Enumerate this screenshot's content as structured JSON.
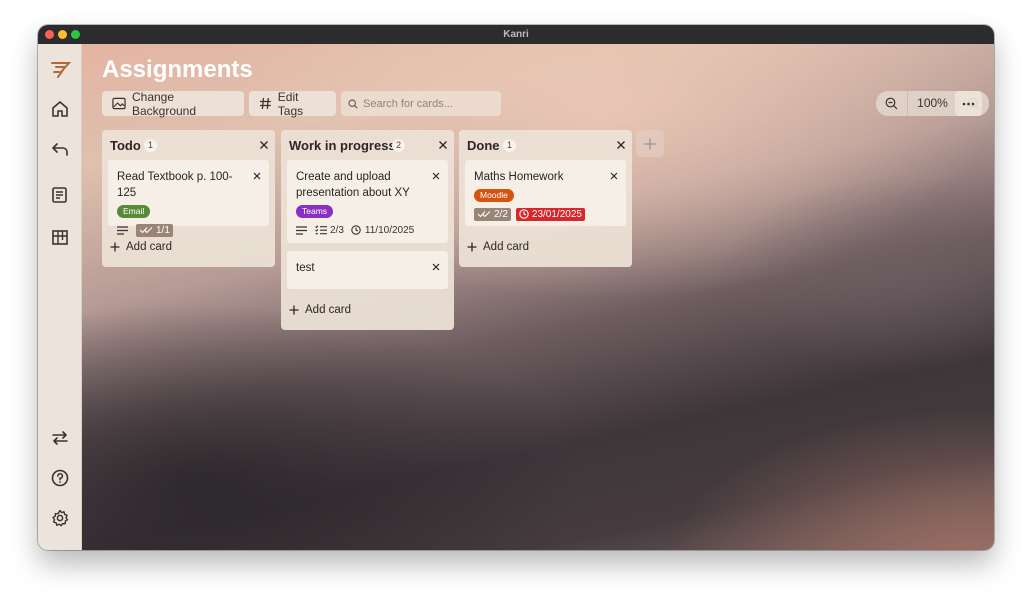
{
  "window": {
    "title": "Kanri"
  },
  "board": {
    "title": "Assignments"
  },
  "toolbar": {
    "change_background": "Change Background",
    "edit_tags": "Edit Tags",
    "search_placeholder": "Search for cards...",
    "zoom_level": "100%"
  },
  "sidebar": {
    "top_icons": [
      "logo-icon",
      "home-icon",
      "back-icon",
      "boards-icon",
      "kanban-icon"
    ],
    "bottom_icons": [
      "import-export-icon",
      "help-icon",
      "settings-icon"
    ]
  },
  "columns": [
    {
      "title": "Todo",
      "count": "1",
      "cards": [
        {
          "title": "Read Textbook p. 100-125",
          "tag": "Email",
          "tag_color": "#5a8a35",
          "has_description": true,
          "checklist": "1/1",
          "checklist_done": true
        }
      ],
      "add_label": "Add card"
    },
    {
      "title": "Work in progress",
      "count": "2",
      "cards": [
        {
          "title": "Create and upload presentation about XY",
          "tag": "Teams",
          "tag_color": "#8a2fc2",
          "has_description": true,
          "checklist": "2/3",
          "checklist_done": false,
          "due": "11/10/2025",
          "due_overdue": false
        },
        {
          "title": "test"
        }
      ],
      "add_label": "Add card"
    },
    {
      "title": "Done",
      "count": "1",
      "cards": [
        {
          "title": "Maths Homework",
          "tag": "Moodle",
          "tag_color": "#d6530f",
          "checklist": "2/2",
          "checklist_done": true,
          "due": "23/01/2025",
          "due_overdue": true,
          "due_color": "#d9262b"
        }
      ],
      "add_label": "Add card"
    }
  ],
  "colors": {
    "accent_logo": "#b06a3a",
    "checklist_done_bg": "#9a8377",
    "overdue": "#d9262b"
  }
}
